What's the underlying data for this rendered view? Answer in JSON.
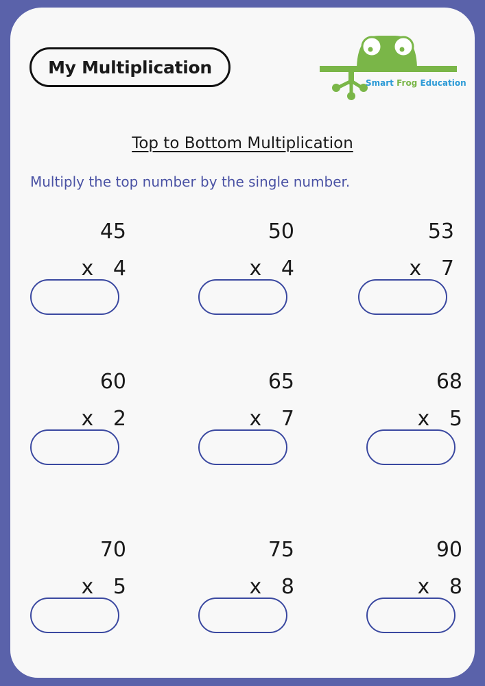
{
  "worksheet": {
    "title": "My Multiplication",
    "brand": {
      "word1": "Smart",
      "word2": "Frog",
      "word3": "Education"
    },
    "heading": "Top to Bottom Multiplication",
    "instruction": "Multiply the top number by the single number.",
    "operator": "x",
    "colors": {
      "frame": "#5a62aa",
      "instruction": "#4a52a4",
      "answer_border": "#3a48a0",
      "logo_green": "#7ab648",
      "logo_blue": "#2c9ad6"
    },
    "problems": [
      {
        "top": "45",
        "multiplier": "4",
        "answer": ""
      },
      {
        "top": "50",
        "multiplier": "4",
        "answer": ""
      },
      {
        "top": "53",
        "multiplier": "7",
        "answer": ""
      },
      {
        "top": "60",
        "multiplier": "2",
        "answer": ""
      },
      {
        "top": "65",
        "multiplier": "7",
        "answer": ""
      },
      {
        "top": "68",
        "multiplier": "5",
        "answer": ""
      },
      {
        "top": "70",
        "multiplier": "5",
        "answer": ""
      },
      {
        "top": "75",
        "multiplier": "8",
        "answer": ""
      },
      {
        "top": "90",
        "multiplier": "8",
        "answer": ""
      }
    ]
  }
}
